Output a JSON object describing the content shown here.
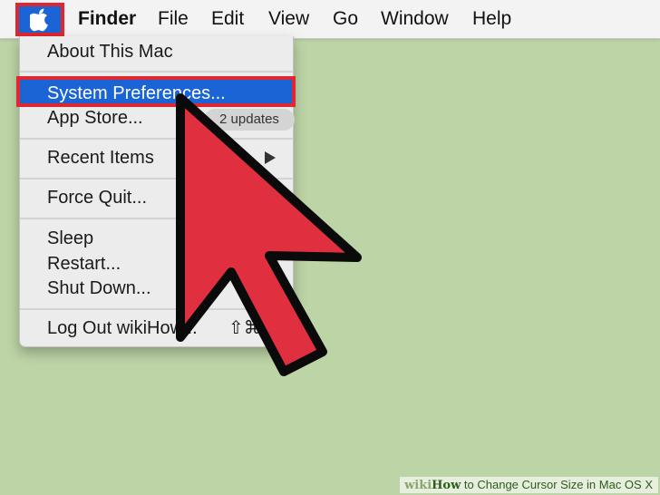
{
  "menubar": {
    "apple_icon": "apple-logo-icon",
    "items": [
      {
        "label": "Finder",
        "bold": true
      },
      {
        "label": "File"
      },
      {
        "label": "Edit"
      },
      {
        "label": "View"
      },
      {
        "label": "Go"
      },
      {
        "label": "Window"
      },
      {
        "label": "Help"
      }
    ]
  },
  "apple_menu": {
    "items": [
      {
        "label": "About This Mac"
      },
      {
        "label": "System Preferences...",
        "highlighted": true
      },
      {
        "label": "App Store...",
        "badge": "2 updates"
      },
      {
        "label": "Recent Items",
        "submenu": true
      },
      {
        "label": "Force Quit..."
      },
      {
        "label": "Sleep"
      },
      {
        "label": "Restart..."
      },
      {
        "label": "Shut Down..."
      },
      {
        "label": "Log Out wikiHow..."
      }
    ],
    "logout_shortcut": "⇧⌘Q"
  },
  "overlay": {
    "cursor_icon": "big-red-arrow-cursor-icon",
    "cursor_color": "#e0303f",
    "highlight_border_color": "#e0262f",
    "selection_color": "#1a64d6"
  },
  "watermark": {
    "brand_wiki": "wiki",
    "brand_how": "How",
    "title": " to Change Cursor Size in Mac OS X"
  }
}
